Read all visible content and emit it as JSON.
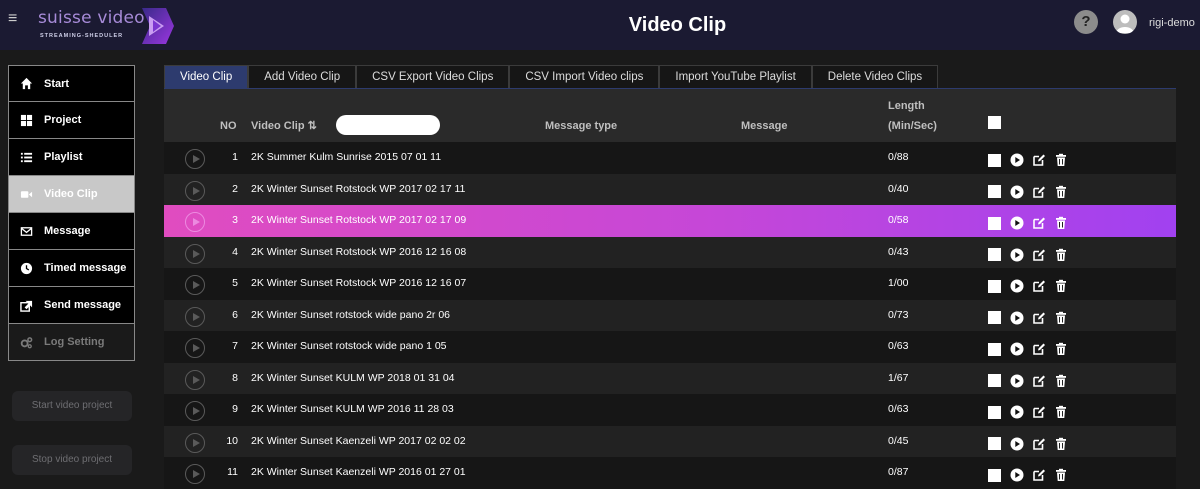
{
  "app": {
    "logo_text": "suisse video",
    "logo_subtitle": "STREAMING-SHEDULER",
    "page_title": "Video Clip",
    "help_label": "?",
    "user_name": "rigi-demo"
  },
  "sidebar": {
    "items": [
      {
        "label": "Start",
        "icon": "home-icon"
      },
      {
        "label": "Project",
        "icon": "grid-icon"
      },
      {
        "label": "Playlist",
        "icon": "list-icon"
      },
      {
        "label": "Video Clip",
        "icon": "video-camera-icon"
      },
      {
        "label": "Message",
        "icon": "envelope-icon"
      },
      {
        "label": "Timed message",
        "icon": "clock-icon"
      },
      {
        "label": "Send message",
        "icon": "share-icon"
      },
      {
        "label": "Log Setting",
        "icon": "gears-icon"
      }
    ],
    "active_index": 3,
    "start_project_label": "Start video project",
    "stop_project_label": "Stop video project"
  },
  "tabs": [
    "Video Clip",
    "Add Video Clip",
    "CSV Export Video Clips",
    "CSV Import Video clips",
    "Import YouTube Playlist",
    "Delete Video Clips"
  ],
  "table": {
    "headers": {
      "no": "NO",
      "video_clip": "Video Clip",
      "sort_icon": "sort-icon",
      "message_type": "Message type",
      "message": "Message",
      "length_line1": "Length",
      "length_line2": "(Min/Sec)"
    },
    "search_value": "",
    "selected_no": "3",
    "rows": [
      {
        "no": "1",
        "name": "2K Summer Kulm Sunrise 2015 07 01 11",
        "length": "0/88"
      },
      {
        "no": "2",
        "name": "2K Winter Sunset Rotstock WP 2017 02 17 11",
        "length": "0/40"
      },
      {
        "no": "3",
        "name": "2K Winter Sunset Rotstock WP 2017 02 17 09",
        "length": "0/58"
      },
      {
        "no": "4",
        "name": "2K Winter Sunset Rotstock WP 2016 12 16 08",
        "length": "0/43"
      },
      {
        "no": "5",
        "name": "2K Winter Sunset Rotstock WP 2016 12 16 07",
        "length": "1/00"
      },
      {
        "no": "6",
        "name": "2K Winter Sunset rotstock wide pano 2r 06",
        "length": "0/73"
      },
      {
        "no": "7",
        "name": "2K Winter Sunset rotstock wide pano 1 05",
        "length": "0/63"
      },
      {
        "no": "8",
        "name": "2K Winter Sunset KULM WP 2018 01 31 04",
        "length": "1/67"
      },
      {
        "no": "9",
        "name": "2K Winter Sunset KULM WP 2016 11 28 03",
        "length": "0/63"
      },
      {
        "no": "10",
        "name": "2K Winter Sunset Kaenzeli WP 2017 02 02 02",
        "length": "0/45"
      },
      {
        "no": "11",
        "name": "2K Winter Sunset Kaenzeli WP 2016 01 27 01",
        "length": "0/87"
      }
    ]
  },
  "colors": {
    "topbar": "#1b1a32",
    "tab_active": "#2d3b6e",
    "row_selected_start": "#e04cc0",
    "row_selected_end": "#a141f0"
  }
}
